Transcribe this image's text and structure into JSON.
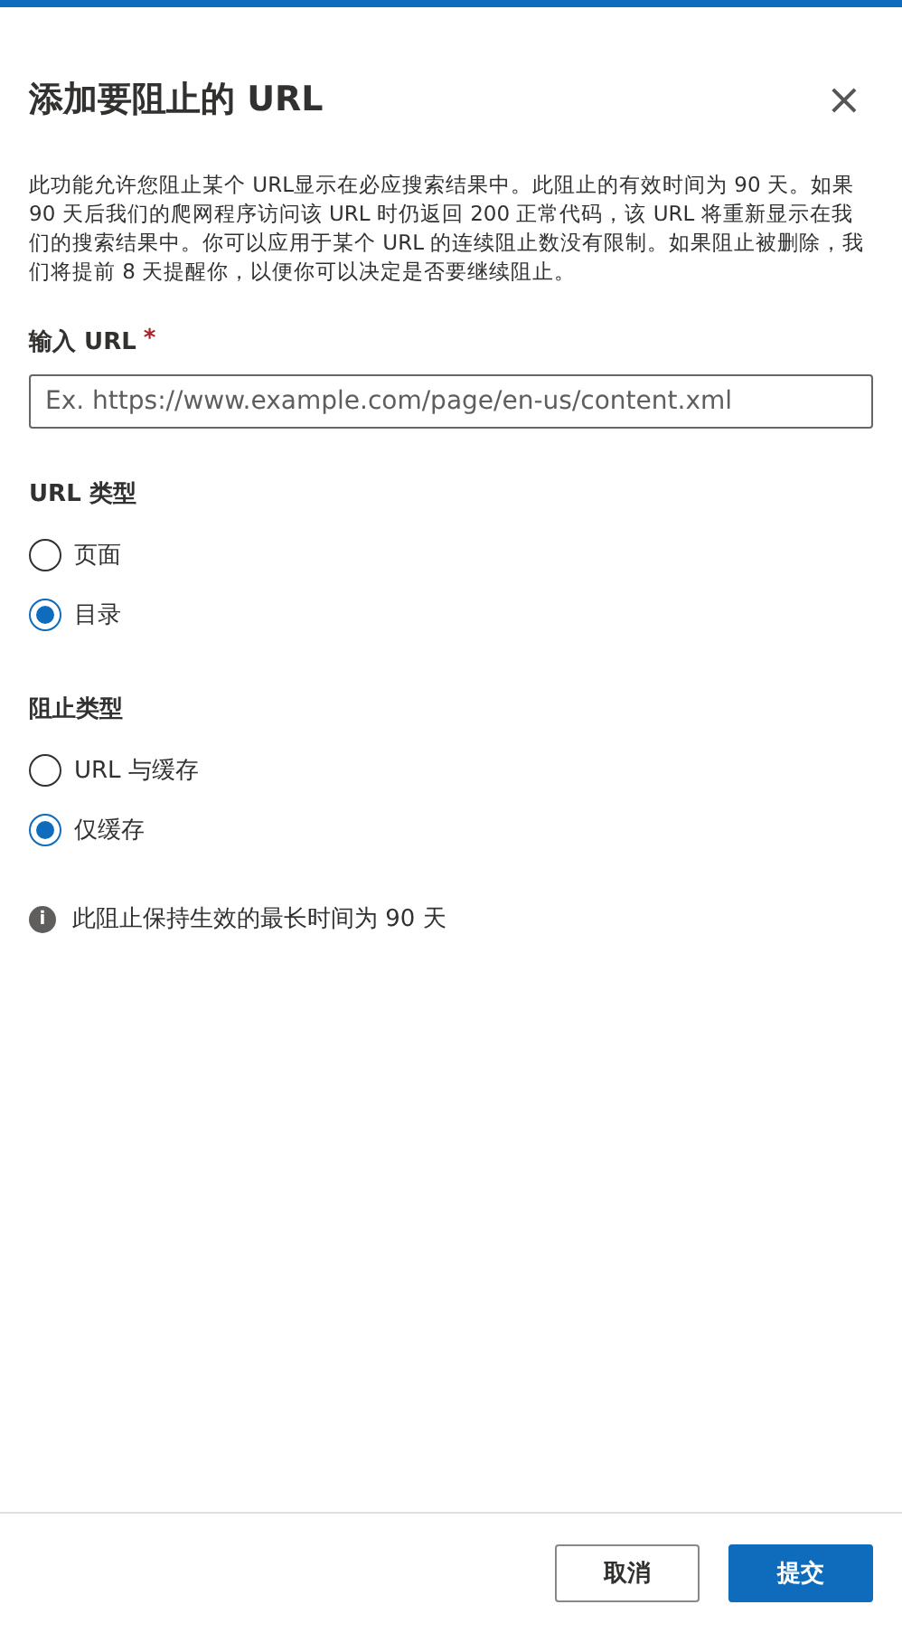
{
  "dialog": {
    "title": "添加要阻止的 URL",
    "close": "×",
    "description": "此功能允许您阻止某个 URL显示在必应搜索结果中。此阻止的有效时间为 90 天。如果 90 天后我们的爬网程序访问该 URL 时仍返回 200 正常代码，该 URL 将重新显示在我们的搜索结果中。你可以应用于某个 URL 的连续阻止数没有限制。如果阻止被删除，我们将提前 8 天提醒你，以便你可以决定是否要继续阻止。"
  },
  "url_field": {
    "label": "输入 URL",
    "required_mark": "*",
    "placeholder": "Ex. https://www.example.com/page/en-us/content.xml"
  },
  "groups": [
    {
      "label": "URL 类型",
      "options": [
        {
          "label": "页面",
          "selected": false
        },
        {
          "label": "目录",
          "selected": true
        }
      ]
    },
    {
      "label": "阻止类型",
      "options": [
        {
          "label": "URL 与缓存",
          "selected": false
        },
        {
          "label": "仅缓存",
          "selected": true
        }
      ]
    }
  ],
  "info": {
    "icon": "i",
    "text": "此阻止保持生效的最长时间为 90 天"
  },
  "buttons": [
    {
      "label": "取消",
      "kind": "secondary"
    },
    {
      "label": "提交",
      "kind": "primary"
    }
  ]
}
